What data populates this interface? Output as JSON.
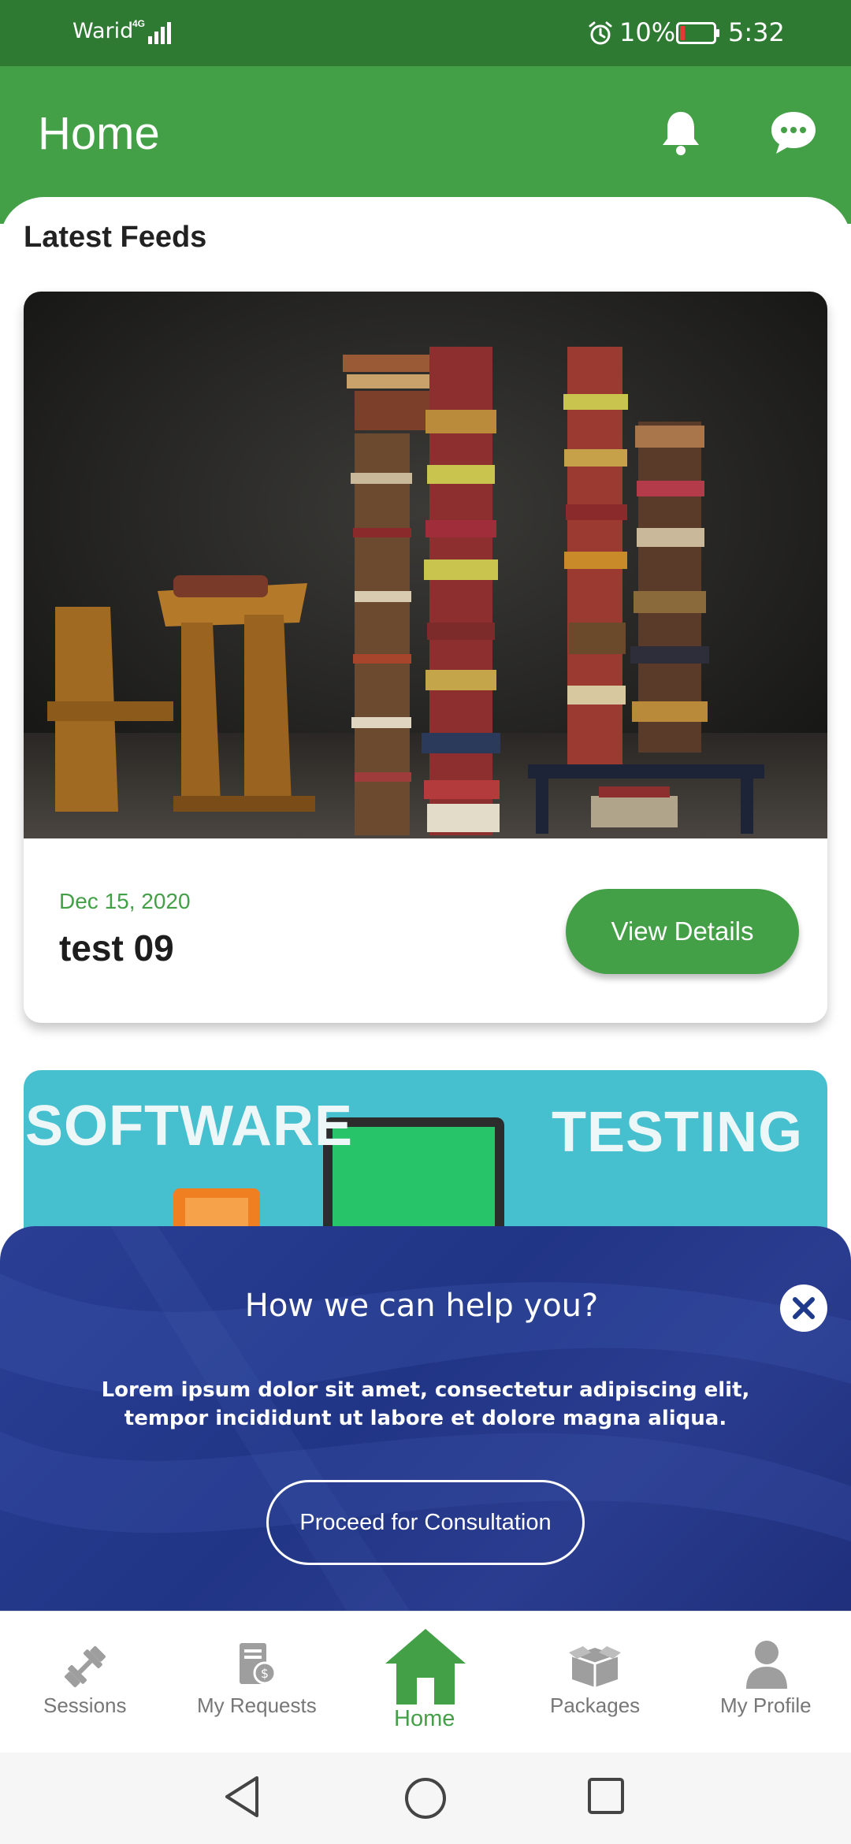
{
  "status_bar": {
    "carrier": "Warid",
    "network": "4G",
    "battery_percent": "10%",
    "time": "5:32",
    "icons": [
      "signal-icon",
      "alarm-icon",
      "battery-low-icon"
    ]
  },
  "app_bar": {
    "title": "Home",
    "icons": [
      "bell-icon",
      "chat-icon"
    ]
  },
  "feeds": {
    "section_title": "Latest Feeds",
    "items": [
      {
        "date": "Dec 15, 2020",
        "title": "test 09",
        "button_label": "View Details",
        "image": "books-and-desk-photo"
      },
      {
        "image_text_left": "SOFTWARE",
        "image_text_right": "TESTING",
        "image": "software-testing-banner"
      }
    ]
  },
  "help_panel": {
    "title": "How we can help you?",
    "text": "Lorem ipsum dolor sit amet, consectetur adipiscing elit, tempor incididunt ut labore et dolore magna aliqua.",
    "button_label": "Proceed for Consultation",
    "close_icon": "close-icon"
  },
  "bottom_nav": {
    "items": [
      {
        "label": "Sessions",
        "icon": "dumbbell-icon",
        "active": false
      },
      {
        "label": "My Requests",
        "icon": "requests-icon",
        "active": false
      },
      {
        "label": "Home",
        "icon": "home-icon",
        "active": true
      },
      {
        "label": "Packages",
        "icon": "package-icon",
        "active": false
      },
      {
        "label": "My Profile",
        "icon": "profile-icon",
        "active": false
      }
    ]
  },
  "colors": {
    "status_bar": "#2f7a32",
    "primary": "#43a047",
    "help_panel": "#223587",
    "inactive_nav": "#9e9e9e"
  }
}
